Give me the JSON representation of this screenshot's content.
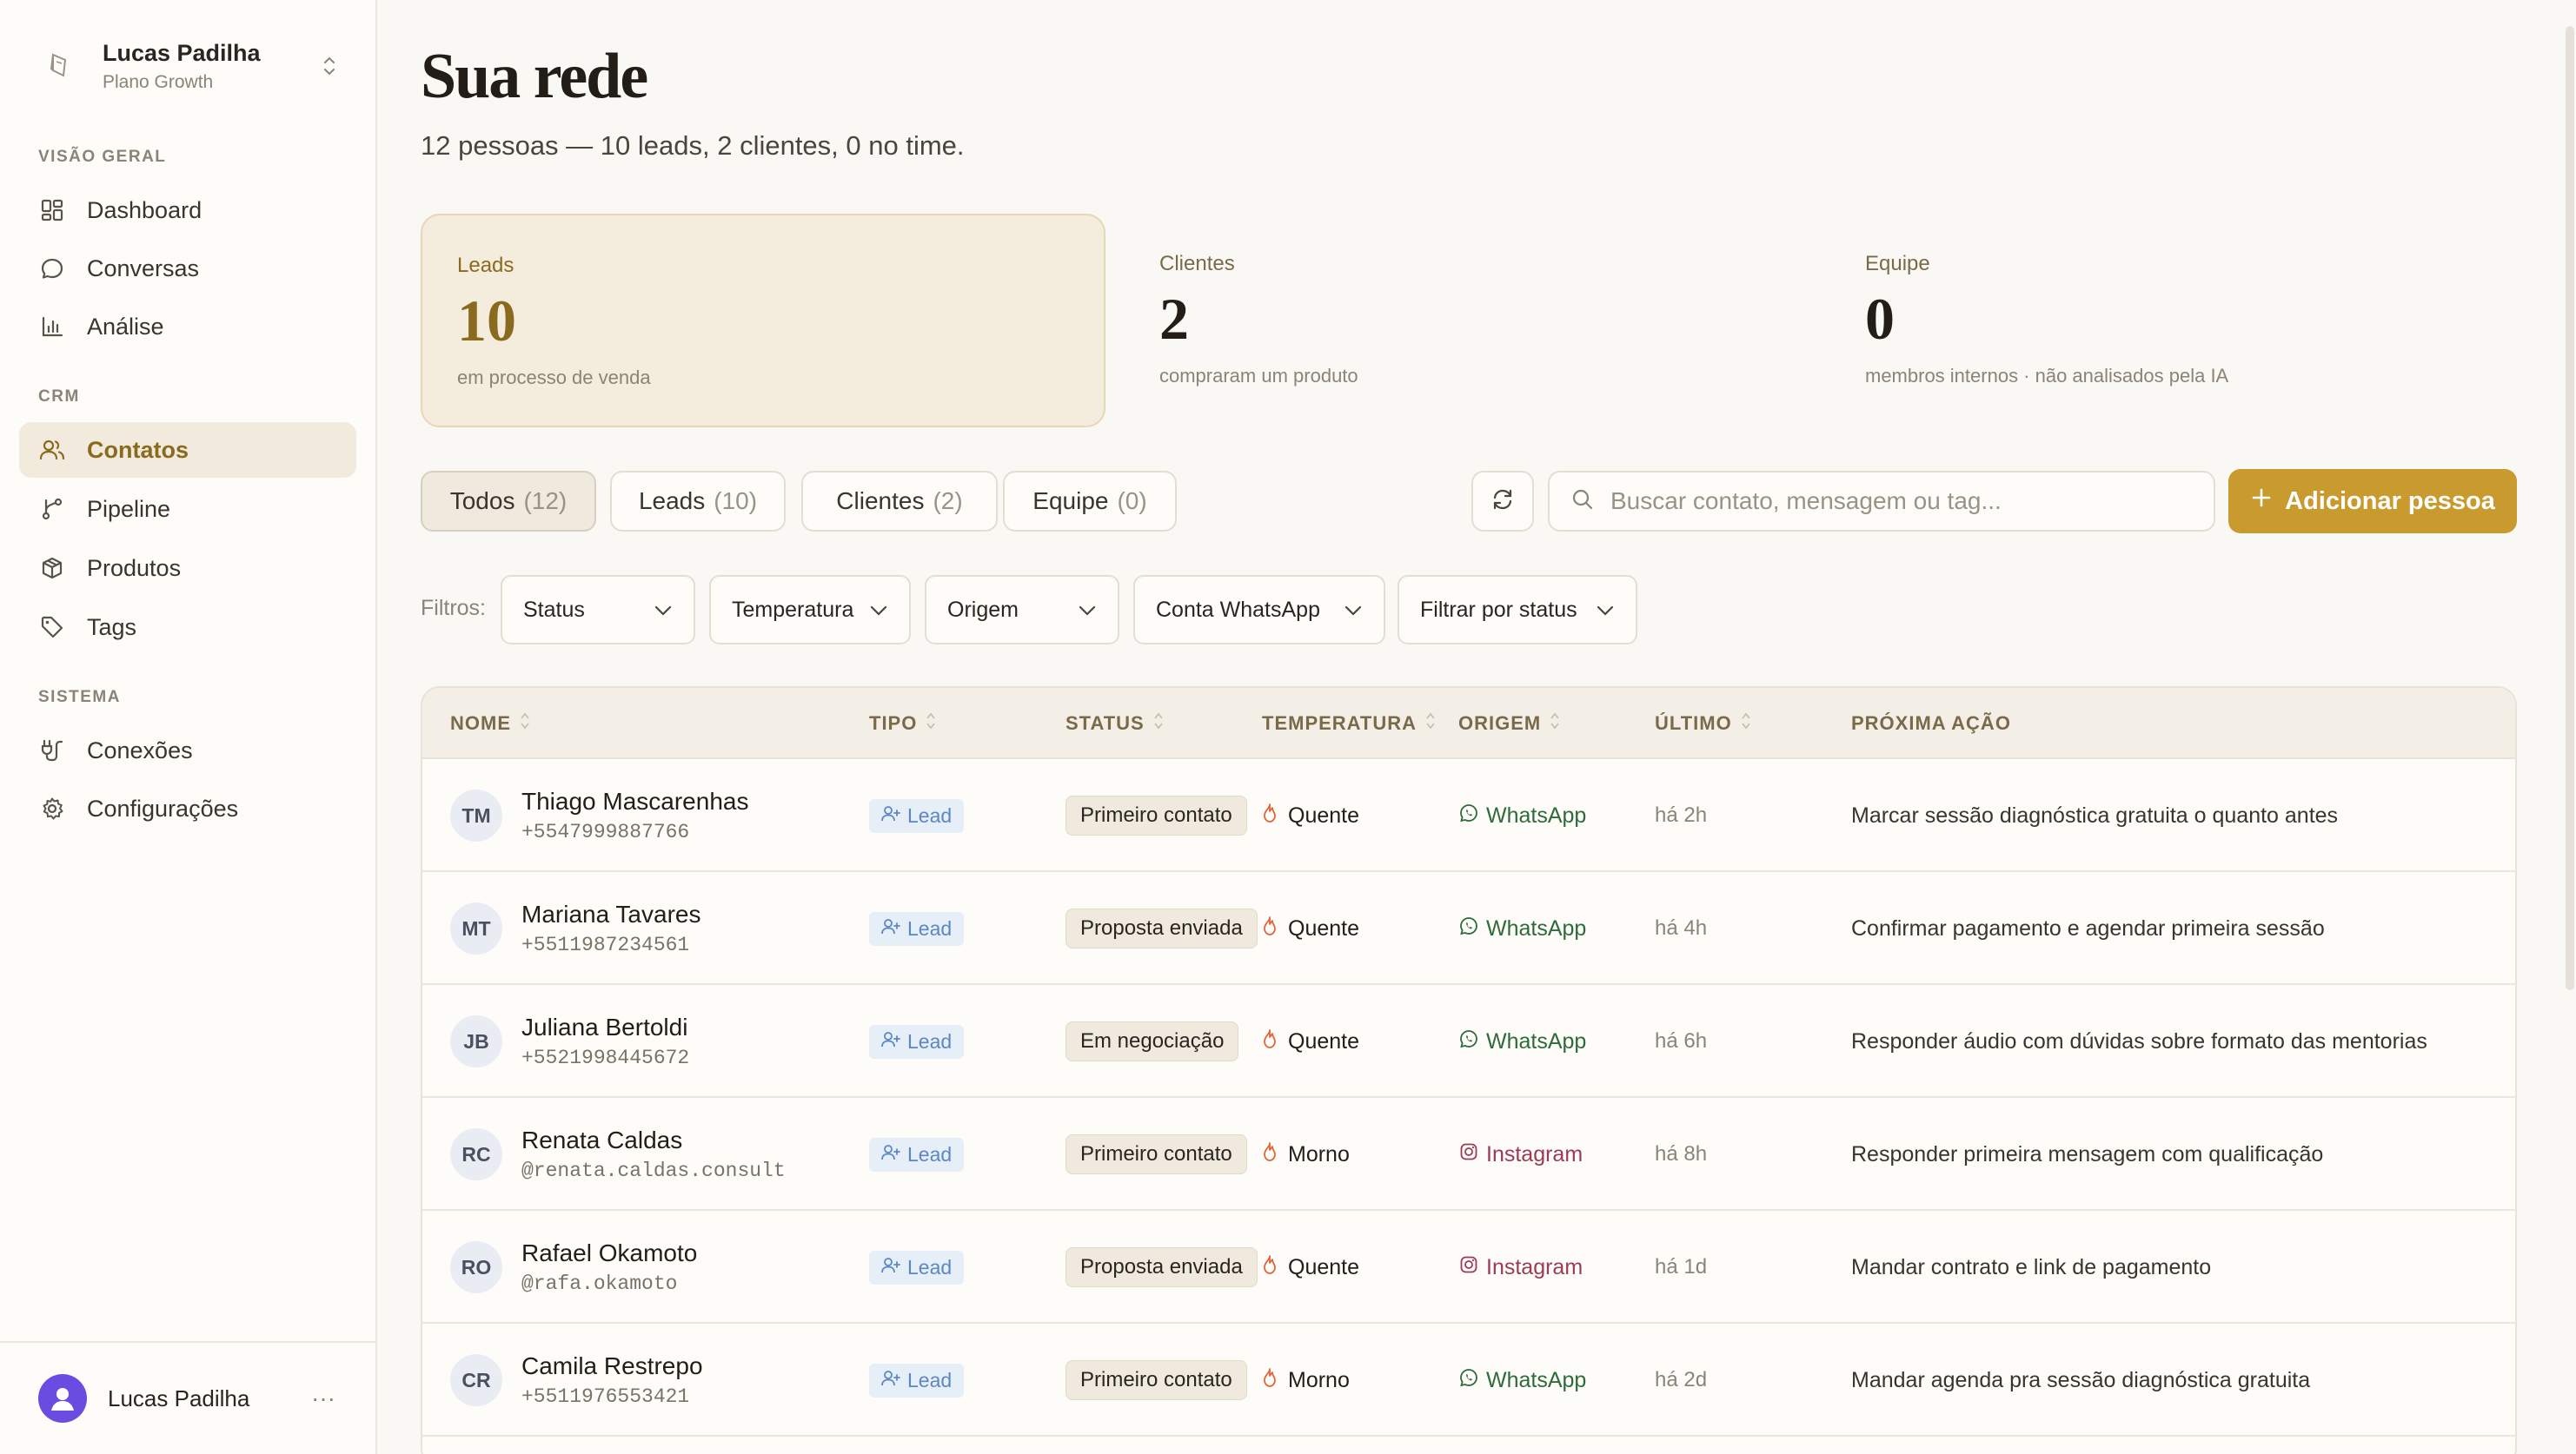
{
  "account": {
    "name": "Lucas Padilha",
    "plan": "Plano Growth"
  },
  "sections": {
    "overview": "VISÃO GERAL",
    "crm": "CRM",
    "system": "SISTEMA"
  },
  "nav": {
    "dashboard": "Dashboard",
    "conversas": "Conversas",
    "analise": "Análise",
    "contatos": "Contatos",
    "pipeline": "Pipeline",
    "produtos": "Produtos",
    "tags": "Tags",
    "conexoes": "Conexões",
    "configuracoes": "Configurações"
  },
  "user": {
    "name": "Lucas Padilha",
    "more": "···"
  },
  "header": {
    "title": "Sua rede",
    "subtitle": "12 pessoas — 10 leads, 2 clientes, 0 no time."
  },
  "stats": {
    "leads": {
      "label": "Leads",
      "value": "10",
      "desc": "em processo de venda"
    },
    "clientes": {
      "label": "Clientes",
      "value": "2",
      "desc": "compraram um produto"
    },
    "equipe": {
      "label": "Equipe",
      "value": "0",
      "desc": "membros internos · não analisados pela IA"
    }
  },
  "tabs": {
    "todos": {
      "label": "Todos",
      "count": "(12)"
    },
    "leads": {
      "label": "Leads",
      "count": "(10)"
    },
    "clientes": {
      "label": "Clientes",
      "count": "(2)"
    },
    "equipe": {
      "label": "Equipe",
      "count": "(0)"
    }
  },
  "search": {
    "placeholder": "Buscar contato, mensagem ou tag..."
  },
  "add_button": "Adicionar pessoa",
  "filters": {
    "label": "Filtros:",
    "status": "Status",
    "temperatura": "Temperatura",
    "origem": "Origem",
    "conta": "Conta WhatsApp",
    "filtrar": "Filtrar por status"
  },
  "table": {
    "headers": {
      "nome": "NOME",
      "tipo": "TIPO",
      "status": "STATUS",
      "temperatura": "TEMPERATURA",
      "origem": "ORIGEM",
      "ultimo": "ÚLTIMO",
      "acao": "PRÓXIMA AÇÃO"
    },
    "rows": [
      {
        "initials": "TM",
        "name": "Thiago Mascarenhas",
        "contact": "+5547999887766",
        "tipo": "Lead",
        "status": "Primeiro contato",
        "temp": "Quente",
        "origem": "WhatsApp",
        "ultimo": "há 2h",
        "acao": "Marcar sessão diagnóstica gratuita o quanto antes"
      },
      {
        "initials": "MT",
        "name": "Mariana Tavares",
        "contact": "+5511987234561",
        "tipo": "Lead",
        "status": "Proposta enviada",
        "temp": "Quente",
        "origem": "WhatsApp",
        "ultimo": "há 4h",
        "acao": "Confirmar pagamento e agendar primeira sessão"
      },
      {
        "initials": "JB",
        "name": "Juliana Bertoldi",
        "contact": "+5521998445672",
        "tipo": "Lead",
        "status": "Em negociação",
        "temp": "Quente",
        "origem": "WhatsApp",
        "ultimo": "há 6h",
        "acao": "Responder áudio com dúvidas sobre formato das mentorias"
      },
      {
        "initials": "RC",
        "name": "Renata Caldas",
        "contact": "@renata.caldas.consult",
        "tipo": "Lead",
        "status": "Primeiro contato",
        "temp": "Morno",
        "origem": "Instagram",
        "ultimo": "há 8h",
        "acao": "Responder primeira mensagem com qualificação"
      },
      {
        "initials": "RO",
        "name": "Rafael Okamoto",
        "contact": "@rafa.okamoto",
        "tipo": "Lead",
        "status": "Proposta enviada",
        "temp": "Quente",
        "origem": "Instagram",
        "ultimo": "há 1d",
        "acao": "Mandar contrato e link de pagamento"
      },
      {
        "initials": "CR",
        "name": "Camila Restrepo",
        "contact": "+5511976553421",
        "tipo": "Lead",
        "status": "Primeiro contato",
        "temp": "Morno",
        "origem": "WhatsApp",
        "ultimo": "há 2d",
        "acao": "Mandar agenda pra sessão diagnóstica gratuita"
      }
    ]
  },
  "colors": {
    "accent": "#c99a2e",
    "accent_dark": "#8a6a1e",
    "whatsapp": "#2f6b3a",
    "instagram": "#9b3b55",
    "lead_badge": "#5b87c4",
    "flame": "#e0653a"
  }
}
